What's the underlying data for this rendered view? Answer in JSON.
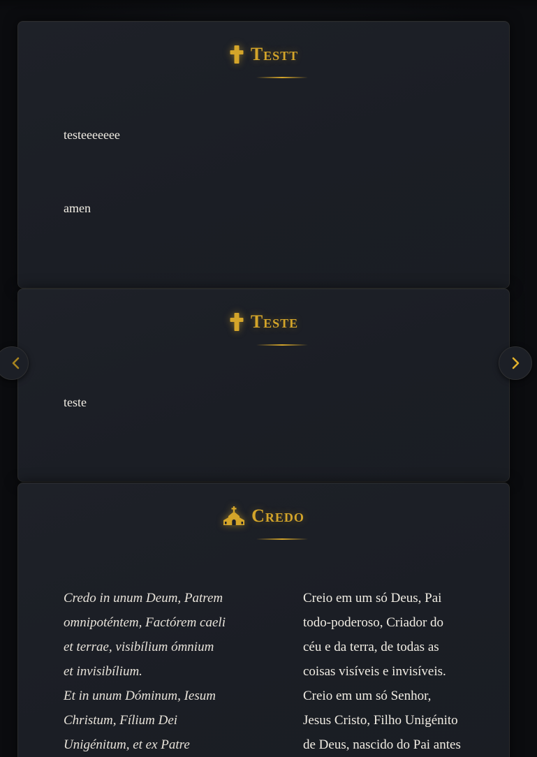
{
  "cards": [
    {
      "title": "Testt",
      "icon": "cross-icon",
      "paragraphs": [
        "testeeeeeee",
        "amen"
      ]
    },
    {
      "title": "Teste",
      "icon": "cross-icon",
      "paragraphs": [
        "teste"
      ]
    },
    {
      "title": "Credo",
      "icon": "church-icon",
      "latin_lines": [
        "Credo in unum Deum, Patrem",
        "omnipoténtem, Factórem caeli",
        "et terrae, visibílium ómnium",
        "et invisibílium.",
        "Et in unum Dóminum, Iesum",
        "Christum, Fílium Dei",
        "Unigénitum, et ex Patre"
      ],
      "portuguese_lines": [
        "Creio em um só Deus, Pai",
        "todo-poderoso, Criador do",
        "céu e da terra, de todas as",
        "coisas visíveis e invisíveis.",
        "Creio em um só Senhor,",
        "Jesus Cristo, Filho Unigénito",
        "de Deus, nascido do Pai antes"
      ]
    }
  ],
  "navigation": {
    "prev_icon": "chevron-left-icon",
    "next_icon": "chevron-right-icon"
  },
  "colors": {
    "accent_gold": "#d4a52a",
    "card_bg": "#1d2027",
    "page_bg": "#0c0d10",
    "text": "#f1ede4"
  }
}
